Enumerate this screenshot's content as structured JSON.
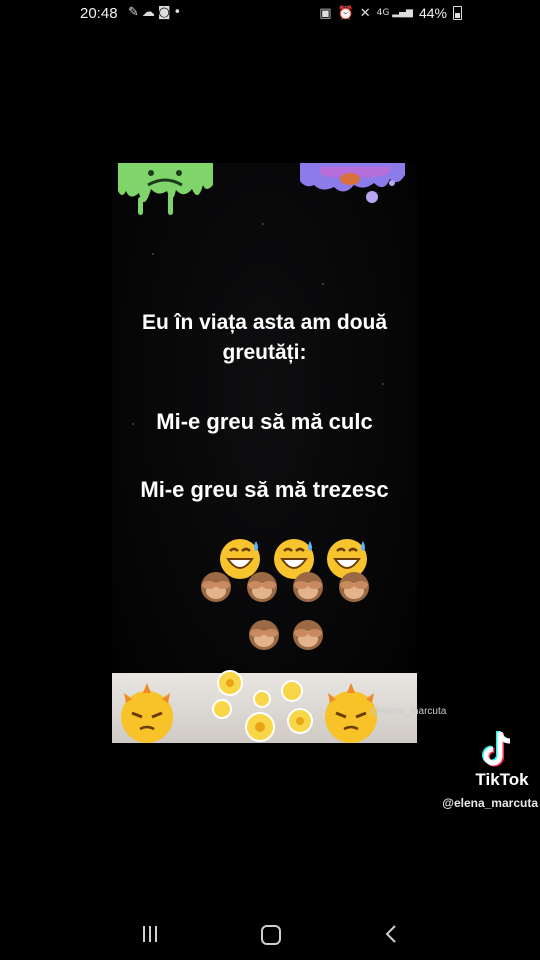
{
  "status_bar": {
    "time": "20:48",
    "left_icons": [
      "whatsapp-icon",
      "cloud-icon",
      "instagram-icon",
      "dot-icon"
    ],
    "right_icons": [
      "nfc-icon",
      "alarm-icon",
      "mute-icon",
      "4g-signal-icon"
    ],
    "network": "4G",
    "battery_percent": "44%"
  },
  "video": {
    "lines": [
      "Eu în viața asta am două",
      "greutăți:",
      "Mi-e greu să mă culc",
      "Mi-e greu să mă trezesc"
    ],
    "stickers": [
      "green-slime-sticker",
      "purple-slime-sticker",
      "grinning-sweat-emoji",
      "see-no-evil-monkey-emoji",
      "angry-sun-sticker",
      "yellow-flowers-sticker"
    ],
    "inner_watermark": "@elena_marcuta"
  },
  "tiktok": {
    "brand": "TikTok",
    "username": "@elena_marcuta"
  },
  "navbar": {
    "buttons": [
      "recents-button",
      "home-button",
      "back-button"
    ]
  },
  "colors": {
    "background": "#000000",
    "text": "#ffffff"
  }
}
